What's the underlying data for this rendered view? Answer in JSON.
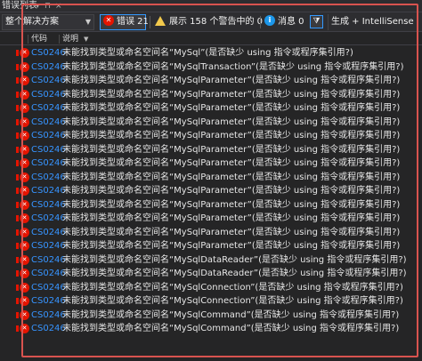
{
  "window": {
    "title": "错误列表"
  },
  "toolbar": {
    "scope_value": "整个解决方案",
    "errors_label": "错误 21",
    "warnings_label": "展示 158 个警告中的 0 个",
    "messages_label": "消息 0",
    "source_label": "生成 + IntelliSense"
  },
  "columns": {
    "code": "代码",
    "description": "说明"
  },
  "rows": [
    {
      "code": "CS0246",
      "description": "未能找到类型或命名空间名“MySql”(是否缺少 using 指令或程序集引用?)"
    },
    {
      "code": "CS0246",
      "description": "未能找到类型或命名空间名“MySqlTransaction”(是否缺少 using 指令或程序集引用?)"
    },
    {
      "code": "CS0246",
      "description": "未能找到类型或命名空间名“MySqlParameter”(是否缺少 using 指令或程序集引用?)"
    },
    {
      "code": "CS0246",
      "description": "未能找到类型或命名空间名“MySqlParameter”(是否缺少 using 指令或程序集引用?)"
    },
    {
      "code": "CS0246",
      "description": "未能找到类型或命名空间名“MySqlParameter”(是否缺少 using 指令或程序集引用?)"
    },
    {
      "code": "CS0246",
      "description": "未能找到类型或命名空间名“MySqlParameter”(是否缺少 using 指令或程序集引用?)"
    },
    {
      "code": "CS0246",
      "description": "未能找到类型或命名空间名“MySqlParameter”(是否缺少 using 指令或程序集引用?)"
    },
    {
      "code": "CS0246",
      "description": "未能找到类型或命名空间名“MySqlParameter”(是否缺少 using 指令或程序集引用?)"
    },
    {
      "code": "CS0246",
      "description": "未能找到类型或命名空间名“MySqlParameter”(是否缺少 using 指令或程序集引用?)"
    },
    {
      "code": "CS0246",
      "description": "未能找到类型或命名空间名“MySqlParameter”(是否缺少 using 指令或程序集引用?)"
    },
    {
      "code": "CS0246",
      "description": "未能找到类型或命名空间名“MySqlParameter”(是否缺少 using 指令或程序集引用?)"
    },
    {
      "code": "CS0246",
      "description": "未能找到类型或命名空间名“MySqlParameter”(是否缺少 using 指令或程序集引用?)"
    },
    {
      "code": "CS0246",
      "description": "未能找到类型或命名空间名“MySqlParameter”(是否缺少 using 指令或程序集引用?)"
    },
    {
      "code": "CS0246",
      "description": "未能找到类型或命名空间名“MySqlParameter”(是否缺少 using 指令或程序集引用?)"
    },
    {
      "code": "CS0246",
      "description": "未能找到类型或命名空间名“MySqlParameter”(是否缺少 using 指令或程序集引用?)"
    },
    {
      "code": "CS0246",
      "description": "未能找到类型或命名空间名“MySqlDataReader”(是否缺少 using 指令或程序集引用?)"
    },
    {
      "code": "CS0246",
      "description": "未能找到类型或命名空间名“MySqlDataReader”(是否缺少 using 指令或程序集引用?)"
    },
    {
      "code": "CS0246",
      "description": "未能找到类型或命名空间名“MySqlConnection”(是否缺少 using 指令或程序集引用?)"
    },
    {
      "code": "CS0246",
      "description": "未能找到类型或命名空间名“MySqlConnection”(是否缺少 using 指令或程序集引用?)"
    },
    {
      "code": "CS0246",
      "description": "未能找到类型或命名空间名“MySqlCommand”(是否缺少 using 指令或程序集引用?)"
    },
    {
      "code": "CS0246",
      "description": "未能找到类型或命名空间名“MySqlCommand”(是否缺少 using 指令或程序集引用?)"
    }
  ],
  "icons": {
    "error": "error-circle-icon",
    "warning": "warning-triangle-icon",
    "info": "info-circle-icon",
    "filter": "filter-icon"
  },
  "colors": {
    "error": "#e51400",
    "code_link": "#3794ff",
    "highlight_box": "#d9534f",
    "selected_border": "#3399ff"
  }
}
